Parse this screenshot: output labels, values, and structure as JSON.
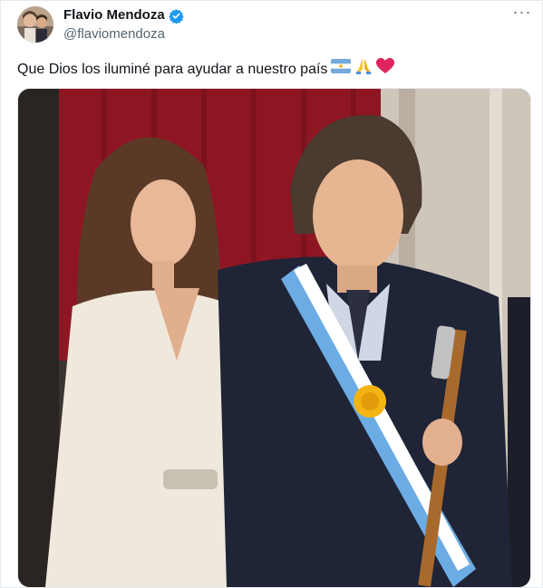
{
  "tweet": {
    "author_name": "Flavio Mendoza",
    "author_handle": "@flaviomendoza",
    "text": "Que Dios los iluminé para ayudar a nuestro país",
    "emojis": [
      "argentina-flag-icon",
      "folded-hands-icon",
      "red-heart-icon"
    ],
    "more_label": "···"
  },
  "colors": {
    "verified": "#1d9bf0",
    "handle": "#536471",
    "sash_blue": "#6cace4",
    "curtain": "#8e1622"
  }
}
